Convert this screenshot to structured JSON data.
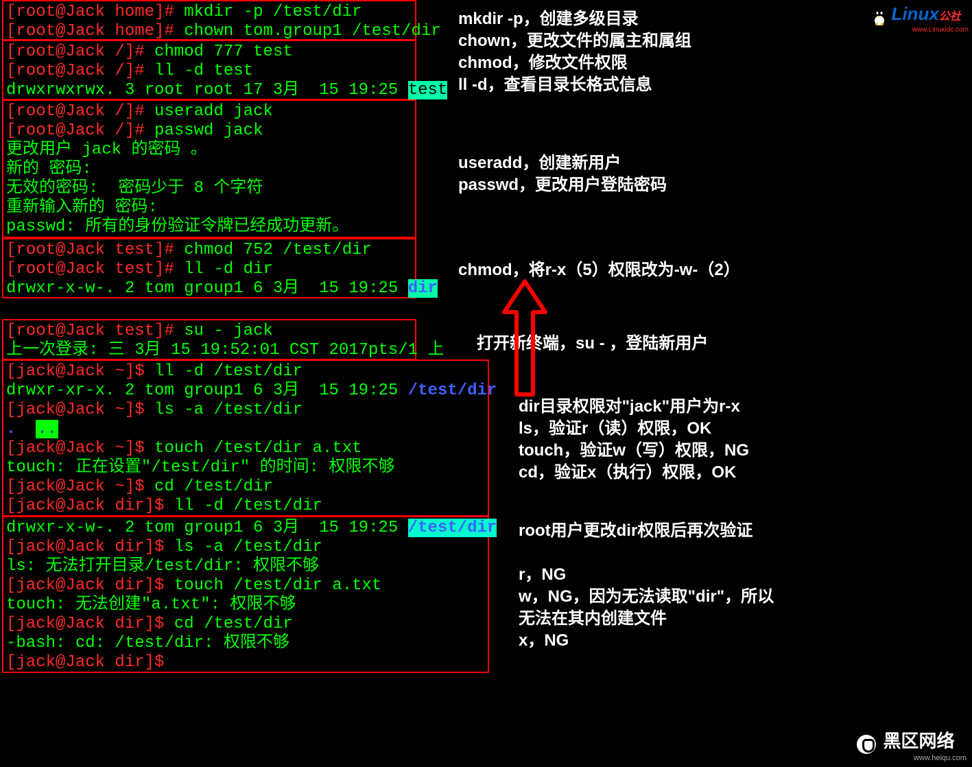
{
  "box1": {
    "l1_prompt": "[root@Jack home]# ",
    "l1_cmd": "mkdir -p /test/dir",
    "l2_prompt": "[root@Jack home]# ",
    "l2_cmd": "chown tom.group1 /test/dir"
  },
  "box2": {
    "l1_prompt": "[root@Jack /]# ",
    "l1_cmd": "chmod 777 test",
    "l2_prompt": "[root@Jack /]# ",
    "l2_cmd": "ll -d test",
    "l3": "drwxrwxrwx. 3 root root 17 3月  15 19:25 ",
    "l3_hl": "test"
  },
  "box3": {
    "l1_prompt": "[root@Jack /]# ",
    "l1_cmd": "useradd jack",
    "l2_prompt": "[root@Jack /]# ",
    "l2_cmd": "passwd jack",
    "l3": "更改用户 jack 的密码 。",
    "l4": "新的 密码:",
    "l5": "无效的密码:  密码少于 8 个字符",
    "l6": "重新输入新的 密码:",
    "l7": "passwd: 所有的身份验证令牌已经成功更新。"
  },
  "box4": {
    "l1_prompt": "[root@Jack test]# ",
    "l1_cmd": "chmod 752 /test/dir",
    "l2_prompt": "[root@Jack test]# ",
    "l2_cmd": "ll -d dir",
    "l3": "drwxr-x-w-. 2 tom group1 6 3月  15 19:25 ",
    "l3_hl": "dir"
  },
  "box5": {
    "l1_prompt": "[root@Jack test]# ",
    "l1_cmd": "su - jack",
    "l2": "上一次登录: 三 3月 15 19:52:01 CST 2017pts/1 上"
  },
  "box6": {
    "l1_prompt": "[jack@Jack ~]$ ",
    "l1_cmd": "ll -d /test/dir",
    "l2a": "drwxr-xr-x. 2 tom group1 6 3月  15 19:25 ",
    "l2b": "/test/dir",
    "l3_prompt": "[jack@Jack ~]$ ",
    "l3_cmd": "ls -a /test/dir",
    "l4a": ".",
    "l4b": "..",
    "l5_prompt": "[jack@Jack ~]$ ",
    "l5_cmd": "touch /test/dir a.txt",
    "l6": "touch: 正在设置\"/test/dir\" 的时间: 权限不够",
    "l7_prompt": "[jack@Jack ~]$ ",
    "l7_cmd": "cd /test/dir",
    "l8_prompt": "[jack@Jack dir]$ ",
    "l8_cmd": "ll -d /test/dir"
  },
  "box7": {
    "l1a": "drwxr-x-w-. 2 tom group1 6 3月  15 19:25 ",
    "l1b": "/test/dir",
    "l2_prompt": "[jack@Jack dir]$ ",
    "l2_cmd": "ls -a /test/dir",
    "l3": "ls: 无法打开目录/test/dir: 权限不够",
    "l4_prompt": "[jack@Jack dir]$ ",
    "l4_cmd": "touch /test/dir a.txt",
    "l5": "touch: 无法创建\"a.txt\": 权限不够",
    "l6_prompt": "[jack@Jack dir]$ ",
    "l6_cmd": "cd /test/dir",
    "l7": "-bash: cd: /test/dir: 权限不够",
    "l8_prompt": "[jack@Jack dir]$ "
  },
  "anno": {
    "a1": "mkdir -p，创建多级目录",
    "a2": "chown，更改文件的属主和属组",
    "a3": "chmod，修改文件权限",
    "a4": "ll -d，查看目录长格式信息",
    "a5": "useradd，创建新用户",
    "a6": "passwd，更改用户登陆密码",
    "a7": "chmod，将r-x（5）权限改为-w-（2）",
    "a8": "打开新终端，su - ，登陆新用户",
    "a9": "dir目录权限对\"jack\"用户为r-x",
    "a10": "ls，验证r（读）权限，OK",
    "a11": "touch，验证w（写）权限，NG",
    "a12": "cd，验证x（执行）权限，OK",
    "a13": "root用户更改dir权限后再次验证",
    "a14": "r，NG",
    "a15": "w，NG，因为无法读取\"dir\"，所以无法在其内创建文件",
    "a16": "x，NG"
  },
  "logos": {
    "linux": "Linux",
    "linux_sub": "公社",
    "linux_url": "www.Linuxidc.com",
    "heiqu": "黑区网络",
    "heiqu_url": "www.heiqu.com"
  }
}
